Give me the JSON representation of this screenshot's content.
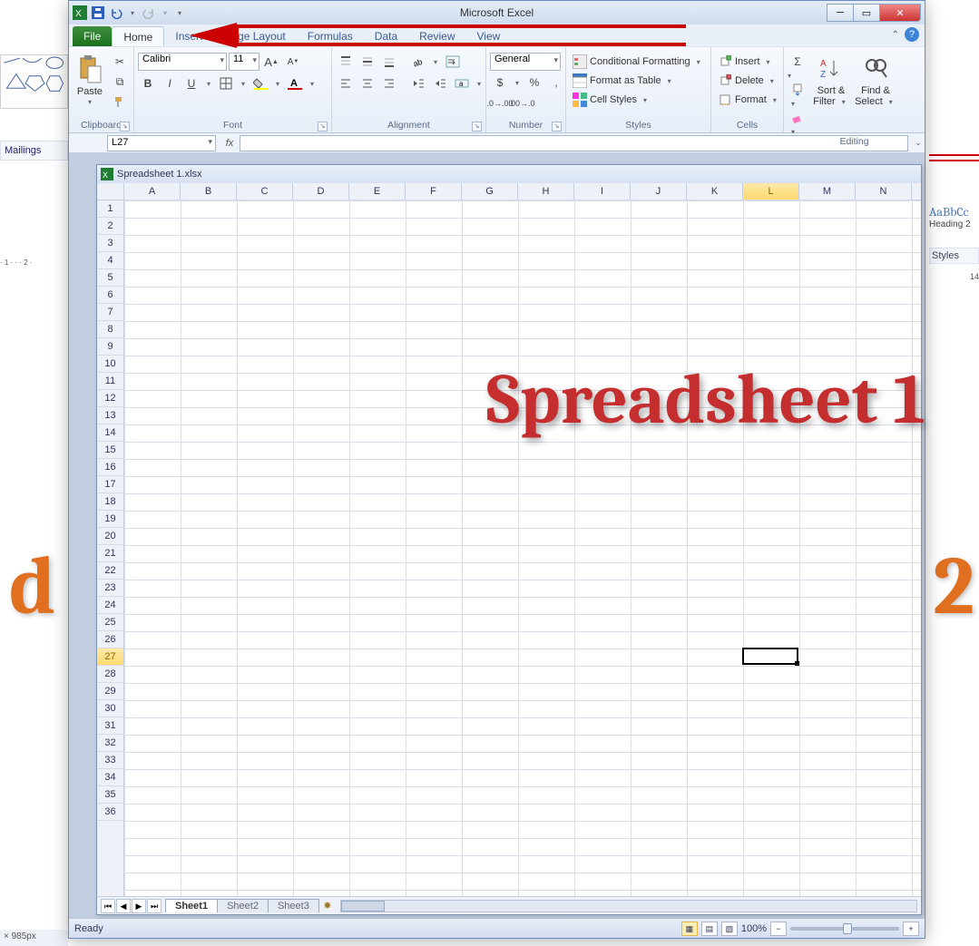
{
  "background": {
    "mailings_label": "Mailings",
    "big_d": "d",
    "big_2": "2",
    "heading_sample": "AaBbCc",
    "heading_name": "Heading 2",
    "styles_header": "Styles",
    "ruler_right": "14",
    "status_left": "× 985px"
  },
  "titlebar": {
    "app_title": "Microsoft Excel"
  },
  "tabs": {
    "file": "File",
    "home": "Home",
    "insert": "Insert",
    "page_layout": "Page Layout",
    "formulas": "Formulas",
    "data": "Data",
    "review": "Review",
    "view": "View"
  },
  "ribbon": {
    "clipboard": {
      "paste": "Paste",
      "label": "Clipboard"
    },
    "font": {
      "name": "Calibri",
      "size": "11",
      "label": "Font"
    },
    "alignment": {
      "label": "Alignment",
      "wrap": "Wrap Text",
      "merge": "Merge & Center"
    },
    "number": {
      "format": "General",
      "label": "Number"
    },
    "styles": {
      "cond": "Conditional Formatting",
      "table": "Format as Table",
      "cell": "Cell Styles",
      "label": "Styles"
    },
    "cells": {
      "insert": "Insert",
      "delete": "Delete",
      "format": "Format",
      "label": "Cells"
    },
    "editing": {
      "sort": "Sort & Filter",
      "find": "Find & Select",
      "label": "Editing"
    }
  },
  "formulabar": {
    "name_box": "L27",
    "fx_label": "fx"
  },
  "document": {
    "title": "Spreadsheet 1.xlsx",
    "columns": [
      "A",
      "B",
      "C",
      "D",
      "E",
      "F",
      "G",
      "H",
      "I",
      "J",
      "K",
      "L",
      "M",
      "N"
    ],
    "selected_col_index": 11,
    "rows_visible": 36,
    "selected_row": 27,
    "overlay_text": "Spreadsheet 1",
    "sheets": [
      "Sheet1",
      "Sheet2",
      "Sheet3"
    ],
    "active_sheet_index": 0
  },
  "statusbar": {
    "status": "Ready",
    "zoom": "100%"
  }
}
